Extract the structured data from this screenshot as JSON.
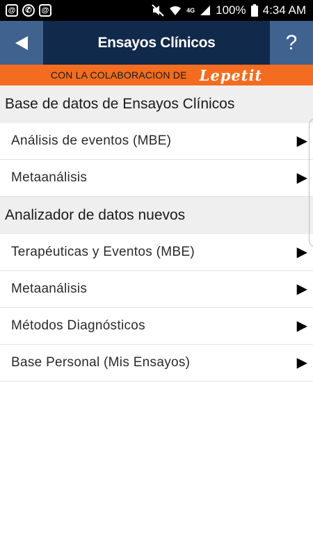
{
  "status_bar": {
    "notif_icons": [
      "@",
      "✆",
      "@"
    ],
    "network": "4G",
    "battery": "100%",
    "time": "4:34 AM"
  },
  "app_bar": {
    "back_symbol": "◀",
    "title": "Ensayos Clínicos",
    "help_symbol": "?"
  },
  "banner": {
    "text": "CON LA COLABORACION DE",
    "logo": "Lepetit"
  },
  "sections": [
    {
      "title": "Base de datos de Ensayos Clínicos",
      "items": [
        "Análisis de eventos (MBE)",
        "Metaanálisis"
      ]
    },
    {
      "title": "Analizador de datos nuevos",
      "items": [
        "Terapéuticas y Eventos (MBE)",
        "Metaanálisis",
        "Métodos Diagnósticos",
        "Base Personal (Mis Ensayos)"
      ]
    }
  ],
  "chevron": "▶",
  "colors": {
    "app_bar": "#11294b",
    "app_bar_button": "#40628f",
    "banner": "#f36c1f",
    "section_header": "#efefef"
  }
}
